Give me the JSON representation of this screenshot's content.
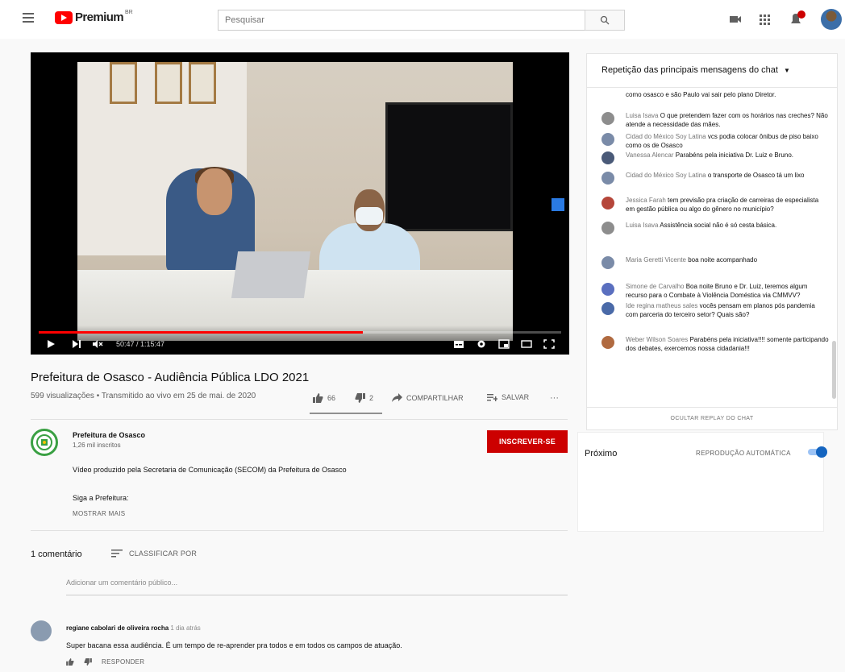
{
  "header": {
    "brand": "Premium",
    "brand_suffix": "BR",
    "search_placeholder": "Pesquisar"
  },
  "player": {
    "time": "50:47 / 1:15:47",
    "progress": 0.62
  },
  "video": {
    "title": "Prefeitura de Osasco - Audiência Pública LDO 2021",
    "meta": "599 visualizações • Transmitido ao vivo em 25 de mai. de 2020",
    "likes": "66",
    "dislikes": "2",
    "share_label": "COMPARTILHAR",
    "save_label": "SALVAR",
    "more_label": "···"
  },
  "channel": {
    "name": "Prefeitura de Osasco",
    "subscribers": "1,26 mil inscritos",
    "subscribe_label": "INSCREVER-SE",
    "description_1": "Vídeo produzido pela Secretaria de Comunicação (SECOM) da Prefeitura de Osasco",
    "description_2": "Siga a Prefeitura:",
    "show_more": "MOSTRAR MAIS"
  },
  "comments": {
    "count_label": "1 comentário",
    "sort_label": "CLASSIFICAR POR",
    "add_placeholder": "Adicionar um comentário público...",
    "items": [
      {
        "author": "regiane cabolari de oliveira rocha",
        "time": "1 dia atrás",
        "text": "Super bacana essa audiência. É um tempo de re-aprender pra todos e em todos os campos de atuação.",
        "reply_label": "RESPONDER"
      }
    ]
  },
  "chat": {
    "header": "Repetição das principais mensagens do chat",
    "partial_text": "como osasco e são Paulo vai sair pelo plano Diretor.",
    "messages": [
      {
        "author": "Luisa Isava",
        "text": "O que pretendem fazer com os horários nas creches? Não atende a necessidade das mães.",
        "color": "#8d8d8d"
      },
      {
        "author": "Cidad do México Soy Latina",
        "text": "vcs podia colocar ônibus de piso baixo como os de Osasco",
        "color": "#7a8ba8"
      },
      {
        "author": "Vanessa Alencar",
        "text": "Parabéns pela iniciativa Dr. Luiz e Bruno.",
        "color": "#4a5a78"
      },
      {
        "author": "Cidad do México Soy Latina",
        "text": "o transporte de Osasco tá um lixo",
        "color": "#7a8ba8"
      },
      {
        "author": "Jessica Farah",
        "text": "tem previsão pra criação de carreiras de especialista em gestão pública ou algo do gênero no município?",
        "color": "#b5463a"
      },
      {
        "author": "Luisa Isava",
        "text": "Assistência social não é só cesta básica.",
        "color": "#8d8d8d"
      },
      {
        "author": "Maria Geretti Vicente",
        "text": "boa noite acompanhado",
        "color": "#7a8ba8"
      },
      {
        "author": "Simone de Carvalho",
        "text": "Boa noite Bruno e Dr. Luiz, teremos algum recurso para o Combate à Violência Doméstica via CMMVV?",
        "color": "#5a6fbf"
      },
      {
        "author": "Ide regina matheus sales",
        "text": "vocês pensam em planos pós pandemia com parceria do terceiro setor? Quais são?",
        "color": "#4a6aa8"
      },
      {
        "author": "Weber Wilson Soares",
        "text": "Parabéns pela iniciativa!!!! somente participando dos debates, exercemos nossa cidadania!!!",
        "color": "#b06a40"
      }
    ],
    "bottom_label": "OCULTAR REPLAY DO CHAT"
  },
  "upnext": {
    "title": "Próximo",
    "autoplay_label": "REPRODUÇÃO AUTOMÁTICA",
    "autoplay_on": true
  },
  "colors": {
    "accent_red": "#cc0000",
    "progress_red": "#ff0000",
    "toggle_blue": "#1565c0"
  }
}
